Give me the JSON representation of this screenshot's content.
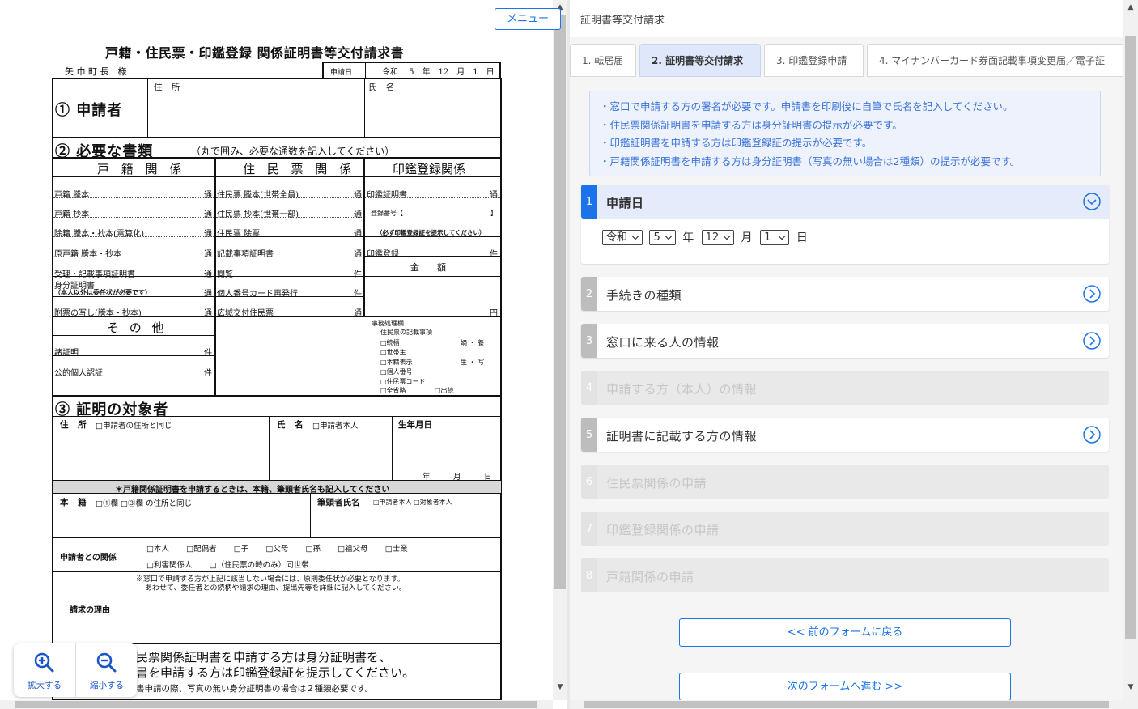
{
  "document": {
    "title": "戸籍・住民票・印鑑登録 関係証明書等交付請求書",
    "addressee": "矢 巾 町 長　様",
    "request_date_label": "申請日",
    "request_date_value": "令和　 5　年　12　月　1　日",
    "sec1_title": "① 申請者",
    "sec1_address": "住 所",
    "sec1_name": "氏 名",
    "sec2_title": "② 必要な書類",
    "sec2_note": "（丸で囲み、必要な通数を記入してください）",
    "col_koseki": "戸 籍 関 係",
    "col_jumin": "住 民 票 関 係",
    "col_inkan": "印鑑登録関係",
    "koseki_items": [
      "戸籍 謄本",
      "戸籍 抄本",
      "除籍 謄本・抄本(電算化)",
      "原戸籍 謄本・抄本",
      "受理・記載事項証明書",
      "身分証明書",
      "附票の写し(謄本・抄本)"
    ],
    "mibun_note": "（本人以外は委任状が必要です）",
    "jumin_items": [
      "住民票 謄本(世帯全員)",
      "住民票 抄本(世帯一部)",
      "住民票 除票",
      "記載事項証明書",
      "閲覧",
      "個人番号カード再発行",
      "広域交付住民票"
    ],
    "inkan_items": [
      "印鑑証明書",
      "登録番号【",
      "（必ず印鑑登録証を提示してください）",
      "印鑑登録"
    ],
    "inkan_bracket_close": "】",
    "unit_tsu": "通",
    "unit_ken": "件",
    "unit_en": "円",
    "amount_label": "金　　額",
    "other_label": "そ の 他",
    "other_items": [
      "諸証明",
      "公的個人認証"
    ],
    "office_title": "事務処理欄",
    "office_items": [
      "住民票の記載事項",
      "□続柄",
      "□世帯主",
      "□本籍表示",
      "□個人番号",
      "□住民票コード",
      "□全省略"
    ],
    "office_right": [
      "嫡 ・ 養",
      "生 ・ 写",
      "□出続"
    ],
    "sec3_title": "③ 証明の対象者",
    "sec3_address": "住 所",
    "sec3_address_opt": "□申請者の住所と同じ",
    "sec3_name": "氏 名",
    "sec3_name_opt": "□申請者本人",
    "sec3_dob": "生年月日",
    "sec3_dob_units": "年　　　月　　　日",
    "koseki_notice": "＊戸籍関係証明書を申請するときは、本籍、筆頭者氏名も記入してください",
    "honseki": "本 籍",
    "honseki_opt": "□①欄 □③欄 の住所と同じ",
    "hitto": "筆頭者氏名",
    "hitto_opt": "□申請者本人 □対象者本人",
    "relation_label": "申請者との関係",
    "relation_opts": [
      "□本人",
      "□配偶者",
      "□子",
      "□父母",
      "□孫",
      "□祖父母",
      "□士業"
    ],
    "relation_opts2": [
      "□利害関係人",
      "□（住民票の時のみ）同世帯"
    ],
    "reason_label": "請求の理由",
    "reason_note1": "※窓口で申請する方が上記に該当しない場合には、原則委任状が必要となります。",
    "reason_note2": "あわせて、委任者との続柄や請求の理由、提出先等を詳細に記入してください。",
    "footer1": "民票関係証明書を申請する方は身分証明書を、",
    "footer2": "書を申請する方は印鑑登録証を提示してください。",
    "footer3": "書申請の際、写真の無い身分証明書の場合は２種類必要です。"
  },
  "zoom": {
    "in_label": "拡大する",
    "out_label": "縮小する"
  },
  "app": {
    "title": "証明書等交付請求",
    "menu_label": "メニュー"
  },
  "tabs": [
    {
      "label": "1. 転居届"
    },
    {
      "label": "2. 証明書等交付請求"
    },
    {
      "label": "3. 印鑑登録申請"
    },
    {
      "label": "4. マイナンバーカード券面記載事項変更届／電子証"
    }
  ],
  "notices": [
    "・窓口で申請する方の署名が必要です。申請書を印刷後に自筆で氏名を記入してください。",
    "・住民票関係証明書を申請する方は身分証明書の提示が必要です。",
    "・印鑑証明書を申請する方は印鑑登録証の提示が必要です。",
    "・戸籍関係証明書を申請する方は身分証明書（写真の無い場合は2種類）の提示が必要です。"
  ],
  "sections": [
    {
      "num": "1",
      "title": "申請日"
    },
    {
      "num": "2",
      "title": "手続きの種類"
    },
    {
      "num": "3",
      "title": "窓口に来る人の情報"
    },
    {
      "num": "4",
      "title": "申請する方（本人）の情報"
    },
    {
      "num": "5",
      "title": "証明書に記載する方の情報"
    },
    {
      "num": "6",
      "title": "住民票関係の申請"
    },
    {
      "num": "7",
      "title": "印鑑登録関係の申請"
    },
    {
      "num": "8",
      "title": "戸籍関係の申請"
    }
  ],
  "date": {
    "era": "令和",
    "year": "5",
    "year_unit": "年",
    "month": "12",
    "month_unit": "月",
    "day": "1",
    "day_unit": "日"
  },
  "nav": {
    "prev": "<< 前のフォームに戻る",
    "next": "次のフォームへ進む >>"
  },
  "colors": {
    "accent": "#1a73e8",
    "notice_text": "#3a74d9",
    "disabled": "#c7c7c7"
  }
}
